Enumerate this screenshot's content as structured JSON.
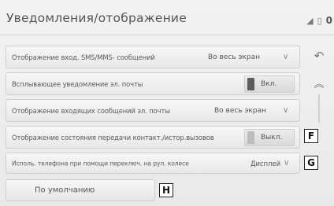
{
  "header": {
    "title": "Уведомления/отображение",
    "signal_icon": "signal-icon",
    "battery_icon": "battery-icon",
    "status_number": "0"
  },
  "rows": [
    {
      "label": "Отображение вход. SMS/MMS- сообщений",
      "value": "Во весь экран",
      "control": "dropdown"
    },
    {
      "label": "Всплывающее уведомление эл. почты",
      "value": "Вкл.",
      "control": "toggle"
    },
    {
      "label": "Отображение входящих сообщений эл. почты",
      "value": "Во весь экран",
      "control": "dropdown"
    },
    {
      "label": "Отображение состояния передачи контакт./истор.вызовов",
      "value": "Выкл.",
      "control": "toggle"
    },
    {
      "label": "Исполь. телефона при помощи переключ. на рул. колесе",
      "value": "Дисплей",
      "control": "dropdown"
    }
  ],
  "default_button": {
    "label": "По умолчанию"
  },
  "callouts": {
    "f": "F",
    "g": "G",
    "h": "H"
  },
  "sidebar": {
    "back_icon": "back-icon",
    "scroll_up_icon": "double-chevron-up-icon"
  }
}
